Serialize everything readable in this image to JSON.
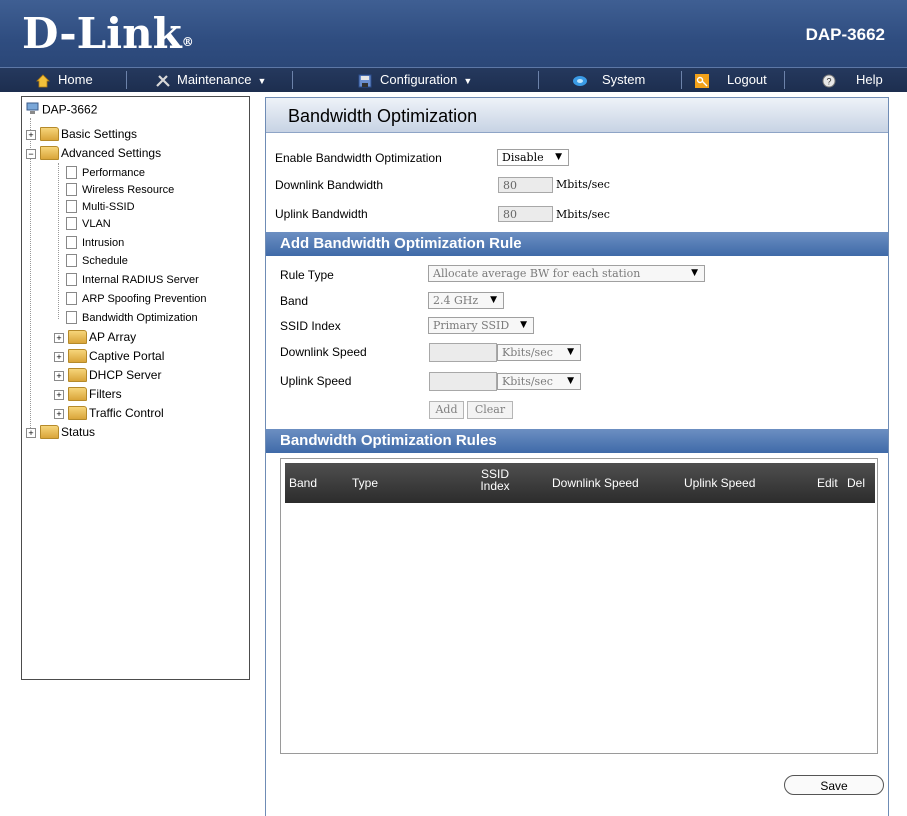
{
  "brand": {
    "logo": "D-Link",
    "reg_mark": "®",
    "model": "DAP-3662"
  },
  "menu": {
    "home": "Home",
    "maintenance": "Maintenance",
    "configuration": "Configuration",
    "system": "System",
    "logout": "Logout",
    "help": "Help",
    "dropdown_arrow": "▼"
  },
  "tree": {
    "root": "DAP-3662",
    "basic_settings": "Basic Settings",
    "advanced_settings": "Advanced Settings",
    "performance": "Performance",
    "wireless_resource": "Wireless Resource",
    "multi_ssid": "Multi-SSID",
    "vlan": "VLAN",
    "intrusion": "Intrusion",
    "schedule": "Schedule",
    "internal_radius": "Internal RADIUS Server",
    "arp_spoofing": "ARP Spoofing Prevention",
    "bandwidth_optimization": "Bandwidth Optimization",
    "ap_array": "AP Array",
    "captive_portal": "Captive Portal",
    "dhcp_server": "DHCP Server",
    "filters": "Filters",
    "traffic_control": "Traffic Control",
    "status": "Status",
    "plus": "+",
    "minus": "−"
  },
  "main": {
    "title": "Bandwidth Optimization",
    "enable_label": "Enable Bandwidth Optimization",
    "enable_value": "Disable",
    "downlink_bw_label": "Downlink Bandwidth",
    "downlink_bw_value": "80",
    "uplink_bw_label": "Uplink Bandwidth",
    "uplink_bw_value": "80",
    "mbits_unit": "Mbits/sec",
    "add_rule_heading": "Add Bandwidth Optimization Rule",
    "rule_type_label": "Rule Type",
    "rule_type_value": "Allocate average BW for each station",
    "band_label": "Band",
    "band_value": "2.4 GHz",
    "ssid_index_label": "SSID Index",
    "ssid_index_value": "Primary SSID",
    "downlink_speed_label": "Downlink Speed",
    "downlink_speed_value": "",
    "uplink_speed_label": "Uplink Speed",
    "uplink_speed_value": "",
    "kbits_unit": "Kbits/sec",
    "add_button": "Add",
    "clear_button": "Clear",
    "rules_heading": "Bandwidth Optimization Rules",
    "columns": {
      "band": "Band",
      "type": "Type",
      "ssid_index_top": "SSID",
      "ssid_index_bottom": "Index",
      "downlink_speed": "Downlink Speed",
      "uplink_speed": "Uplink Speed",
      "edit": "Edit",
      "del": "Del"
    },
    "save_button": "Save"
  },
  "colors": {
    "header_bg": "#2f4d80",
    "menubar_bg": "#1d2e4f",
    "section_head_bg": "#3f6aa8",
    "table_head_bg": "#2c2c2c"
  }
}
